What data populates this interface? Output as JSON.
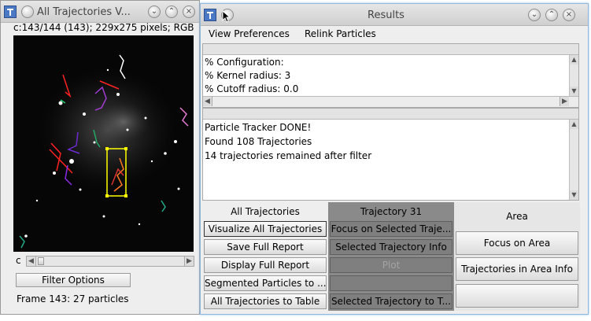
{
  "image_window": {
    "title": "All Trajectories V...",
    "info": "c:143/144 (143); 229x275 pixels; RGB",
    "slice_label": "c",
    "filter_button": "Filter Options",
    "status": "Frame 143: 27 particles",
    "buttons": {
      "minimize": "chevron-down-icon",
      "maximize": "chevron-up-icon",
      "close": "close-icon"
    }
  },
  "results_window": {
    "title": "Results",
    "menu": [
      "View Preferences",
      "Relink Particles"
    ],
    "config_lines": [
      "% Configuration:",
      "% Kernel radius: 3",
      "% Cutoff radius: 0.0"
    ],
    "log_lines": [
      "Particle Tracker DONE!",
      "Found 108 Trajectories",
      "14 trajectories remained after filter"
    ],
    "all_trajectories": {
      "header": "All Trajectories",
      "buttons": [
        "Visualize All Trajectories",
        "Save Full Report",
        "Display Full Report",
        "Segmented Particles to ...",
        "All Trajectories to Table"
      ]
    },
    "trajectory": {
      "header": "Trajectory 31",
      "buttons": [
        "Focus on Selected Traje...",
        "Selected Trajectory Info",
        "Plot",
        "",
        "Selected Trajectory to T..."
      ]
    },
    "area": {
      "header": "Area",
      "buttons": [
        "Focus on Area",
        "Trajectories in Area Info",
        ""
      ]
    }
  },
  "colors": {
    "button_dark": "#7f7f7f",
    "selection_box": "#ffff00",
    "window_focus_border": "#8fb7de"
  }
}
